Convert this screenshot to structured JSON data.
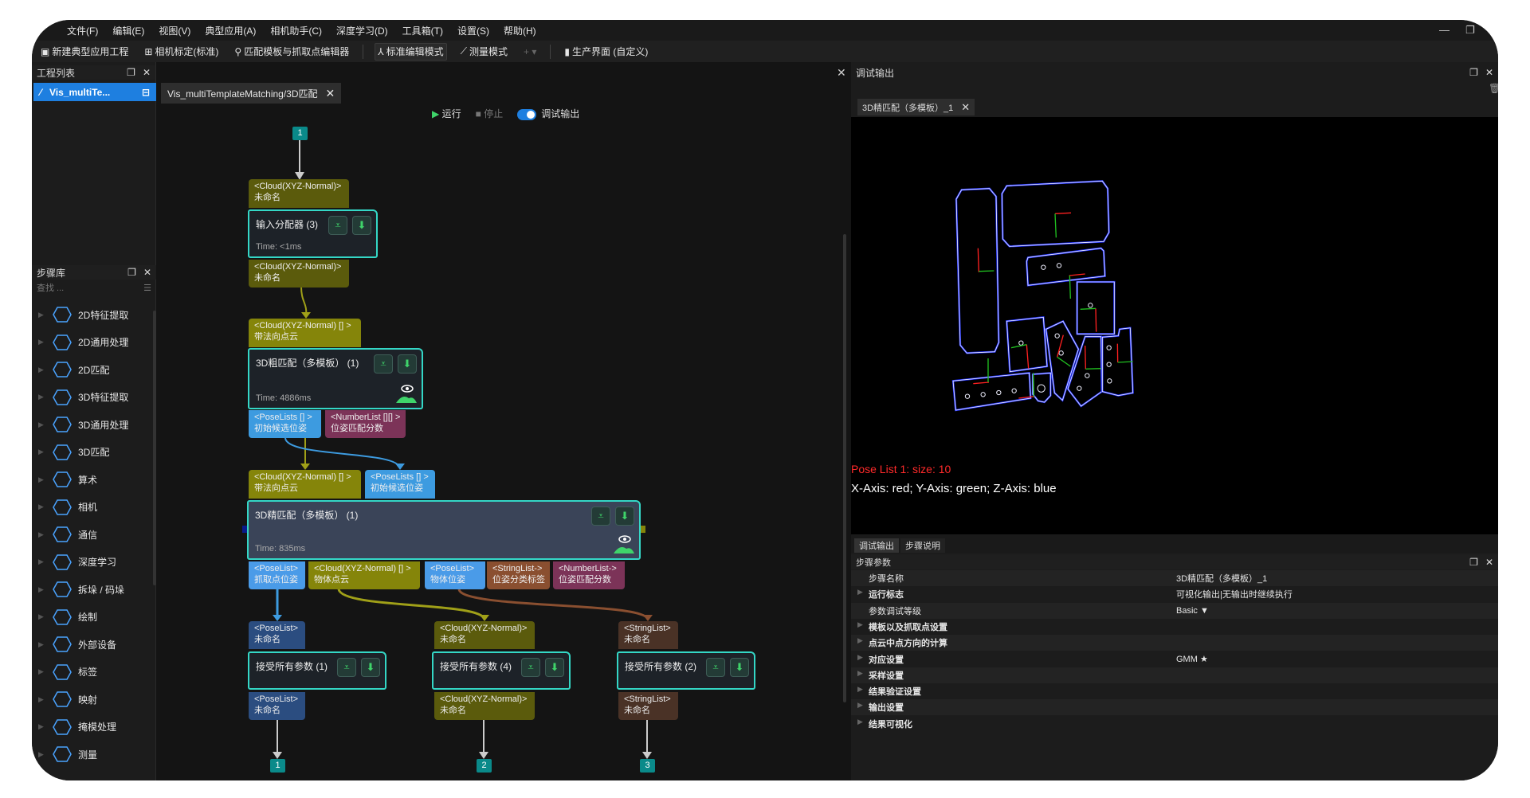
{
  "menu": [
    "文件(F)",
    "编辑(E)",
    "视图(V)",
    "典型应用(A)",
    "相机助手(C)",
    "深度学习(D)",
    "工具箱(T)",
    "设置(S)",
    "帮助(H)"
  ],
  "toolbar": {
    "new_project": "新建典型应用工程",
    "calib": "相机标定(标准)",
    "match_editor": "匹配模板与抓取点编辑器",
    "std_mode": "标准编辑模式",
    "measure_mode": "测量模式",
    "plus": "+ ▾",
    "production": "生产界面 (自定义)"
  },
  "project_panel": {
    "title": "工程列表",
    "item": "Vis_multiTe..."
  },
  "step_library": {
    "title": "步骤库",
    "search_placeholder": "查找 ...",
    "items": [
      {
        "label": "2D特征提取",
        "icon": "2d-feature-icon"
      },
      {
        "label": "2D通用处理",
        "icon": "2d-process-icon"
      },
      {
        "label": "2D匹配",
        "icon": "2d-match-icon"
      },
      {
        "label": "3D特征提取",
        "icon": "3d-feature-icon"
      },
      {
        "label": "3D通用处理",
        "icon": "3d-process-icon"
      },
      {
        "label": "3D匹配",
        "icon": "3d-match-icon"
      },
      {
        "label": "算术",
        "icon": "arithmetic-icon"
      },
      {
        "label": "相机",
        "icon": "camera-icon"
      },
      {
        "label": "通信",
        "icon": "communication-icon"
      },
      {
        "label": "深度学习",
        "icon": "ai-icon"
      },
      {
        "label": "拆垛 / 码垛",
        "icon": "boxes-icon"
      },
      {
        "label": "绘制",
        "icon": "pen-icon"
      },
      {
        "label": "外部设备",
        "icon": "device-icon"
      },
      {
        "label": "标签",
        "icon": "tag-icon"
      },
      {
        "label": "映射",
        "icon": "mapping-icon"
      },
      {
        "label": "掩模处理",
        "icon": "mask-icon"
      },
      {
        "label": "测量",
        "icon": "measure-icon"
      }
    ]
  },
  "editor": {
    "tab": "Vis_multiTemplateMatching/3D匹配",
    "run": "运行",
    "stop": "停止",
    "debug": "调试输出",
    "debug_on": true
  },
  "graph": {
    "inputs": [
      "1"
    ],
    "nodes": [
      {
        "title": "输入分配器 (3)",
        "time": "Time: <1ms",
        "in": [
          {
            "type": "<Cloud(XYZ-Normal)>",
            "name": "未命名"
          }
        ],
        "out": [
          {
            "type": "<Cloud(XYZ-Normal)>",
            "name": "未命名"
          }
        ]
      },
      {
        "title": "3D粗匹配（多模板） (1)",
        "time": "Time: 4886ms",
        "in": [
          {
            "type": "<Cloud(XYZ-Normal) [] >",
            "name": "带法向点云"
          }
        ],
        "out": [
          {
            "type": "<PoseLists [] >",
            "name": "初始候选位姿"
          },
          {
            "type": "<NumberList [][] >",
            "name": "位姿匹配分数"
          }
        ]
      },
      {
        "title": "3D精匹配（多模板） (1)",
        "time": "Time: 835ms",
        "in": [
          {
            "type": "<Cloud(XYZ-Normal) [] >",
            "name": "带法向点云"
          },
          {
            "type": "<PoseLists [] >",
            "name": "初始候选位姿"
          }
        ],
        "out": [
          {
            "type": "<PoseList>",
            "name": "抓取点位姿"
          },
          {
            "type": "<Cloud(XYZ-Normal) [] >",
            "name": "物体点云"
          },
          {
            "type": "<PoseList>",
            "name": "物体位姿"
          },
          {
            "type": "<StringList->",
            "name": "位姿分类标签"
          },
          {
            "type": "<NumberList->",
            "name": "位姿匹配分数"
          }
        ]
      },
      {
        "title": "接受所有参数 (1)",
        "in": [
          {
            "type": "<PoseList>",
            "name": "未命名"
          }
        ],
        "out": [
          {
            "type": "<PoseList>",
            "name": "未命名"
          }
        ]
      },
      {
        "title": "接受所有参数 (4)",
        "in": [
          {
            "type": "<Cloud(XYZ-Normal)>",
            "name": "未命名"
          }
        ],
        "out": [
          {
            "type": "<Cloud(XYZ-Normal)>",
            "name": "未命名"
          }
        ]
      },
      {
        "title": "接受所有参数 (2)",
        "in": [
          {
            "type": "<StringList>",
            "name": "未命名"
          }
        ],
        "out": [
          {
            "type": "<StringList>",
            "name": "未命名"
          }
        ]
      }
    ],
    "outputs": [
      "1",
      "2",
      "3"
    ]
  },
  "debug_panel": {
    "title": "调试输出",
    "tab": "3D精匹配（多模板）_1",
    "pose_info": "Pose List 1: size: 10",
    "axis_info": "X-Axis: red; Y-Axis: green; Z-Axis: blue",
    "axis_colors": {
      "x": "#ff2020",
      "y": "#20c020",
      "z": "#2030ff"
    }
  },
  "bottom_tabs": [
    "调试输出",
    "步骤说明"
  ],
  "params": {
    "title": "步骤参数",
    "rows": [
      {
        "key": "步骤名称",
        "value": "3D精匹配（多模板）_1",
        "expand": false
      },
      {
        "key": "运行标志",
        "value": "可视化输出|无输出时继续执行",
        "expand": true
      },
      {
        "key": "参数调试等级",
        "value": "Basic ▼",
        "expand": false
      },
      {
        "key": "模板以及抓取点设置",
        "value": "",
        "expand": true
      },
      {
        "key": "点云中点方向的计算",
        "value": "",
        "expand": true
      },
      {
        "key": "对应设置",
        "value": "GMM ★",
        "expand": true
      },
      {
        "key": "采样设置",
        "value": "",
        "expand": true
      },
      {
        "key": "结果验证设置",
        "value": "",
        "expand": true
      },
      {
        "key": "输出设置",
        "value": "",
        "expand": true
      },
      {
        "key": "结果可视化",
        "value": "",
        "expand": true
      }
    ]
  }
}
